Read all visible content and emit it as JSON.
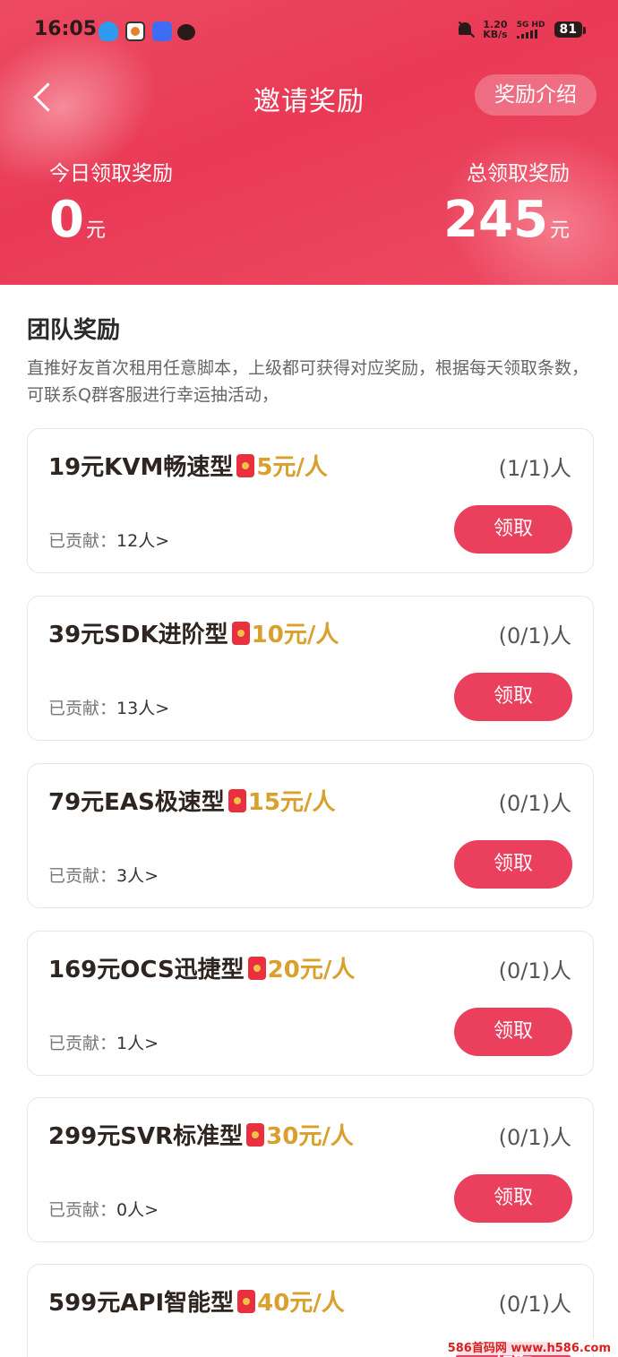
{
  "status_bar": {
    "time": "16:05",
    "net_speed_value": "1.20",
    "net_speed_unit": "KB/s",
    "network": "5G HD",
    "battery": "81"
  },
  "navbar": {
    "title": "邀请奖励",
    "intro_label": "奖励介绍"
  },
  "stats": {
    "today_label": "今日领取奖励",
    "today_value": "0",
    "today_unit": "元",
    "total_label": "总领取奖励",
    "total_value": "245",
    "total_unit": "元"
  },
  "section": {
    "title": "团队奖励",
    "description": "直推好友首次租用任意脚本，上级都可获得对应奖励，根据每天领取条数，可联系Q群客服进行幸运抽活动，"
  },
  "cards": [
    {
      "name": "19元KVM畅速型",
      "reward": "5元/人",
      "quota": "(1/1)人",
      "contrib_label": "已贡献：",
      "contrib_count": "12人>",
      "button": "领取"
    },
    {
      "name": "39元SDK进阶型",
      "reward": "10元/人",
      "quota": "(0/1)人",
      "contrib_label": "已贡献：",
      "contrib_count": "13人>",
      "button": "领取"
    },
    {
      "name": "79元EAS极速型",
      "reward": "15元/人",
      "quota": "(0/1)人",
      "contrib_label": "已贡献：",
      "contrib_count": "3人>",
      "button": "领取"
    },
    {
      "name": "169元OCS迅捷型",
      "reward": "20元/人",
      "quota": "(0/1)人",
      "contrib_label": "已贡献：",
      "contrib_count": "1人>",
      "button": "领取"
    },
    {
      "name": "299元SVR标准型",
      "reward": "30元/人",
      "quota": "(0/1)人",
      "contrib_label": "已贡献：",
      "contrib_count": "0人>",
      "button": "领取"
    },
    {
      "name": "599元API智能型",
      "reward": "40元/人",
      "quota": "(0/1)人",
      "contrib_label": "",
      "contrib_count": "",
      "button": "领取"
    }
  ],
  "watermark": "586首码网 www.h586.com",
  "colors": {
    "header_bg": "#e93a56",
    "claim_button": "#ea3f5d",
    "reward_gold": "#d9a02e"
  },
  "icons": {
    "back": "chevron-left-icon",
    "red_envelope": "red-envelope-icon",
    "mute": "bell-off-icon"
  }
}
